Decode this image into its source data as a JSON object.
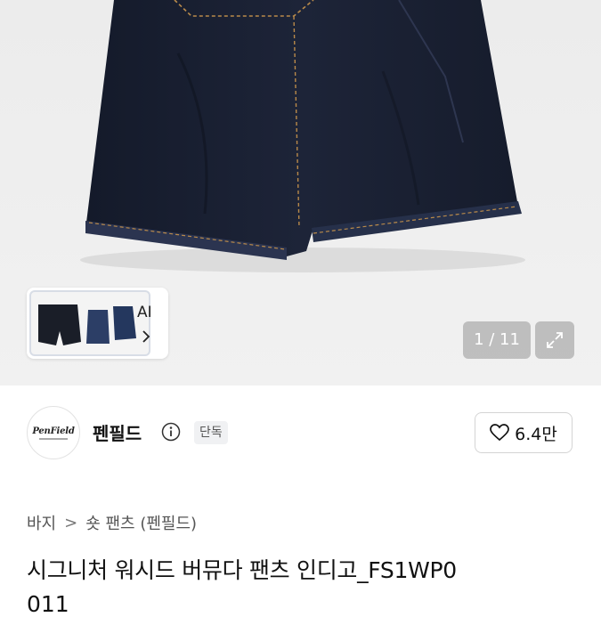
{
  "gallery": {
    "counter": "1 / 11",
    "thumbnail_label": "AI",
    "icons": {
      "next": "chevron-right-icon",
      "expand": "expand-arrows-icon"
    }
  },
  "brand": {
    "logo_text": "PenField",
    "name": "펜필드",
    "badge": "단독",
    "icons": {
      "info": "info-icon",
      "like": "heart-icon"
    }
  },
  "like": {
    "count": "6.4만"
  },
  "breadcrumb": {
    "items": [
      "바지",
      "숏 팬츠 (펜필드)"
    ],
    "separator": ">"
  },
  "product": {
    "title": "시그니처 워시드 버뮤다 팬츠 인디고_FS1WP0",
    "title_continued": "011"
  },
  "colors": {
    "denim": "#1c2233",
    "stitch": "#b98a4a",
    "background": "#eeeeee"
  }
}
